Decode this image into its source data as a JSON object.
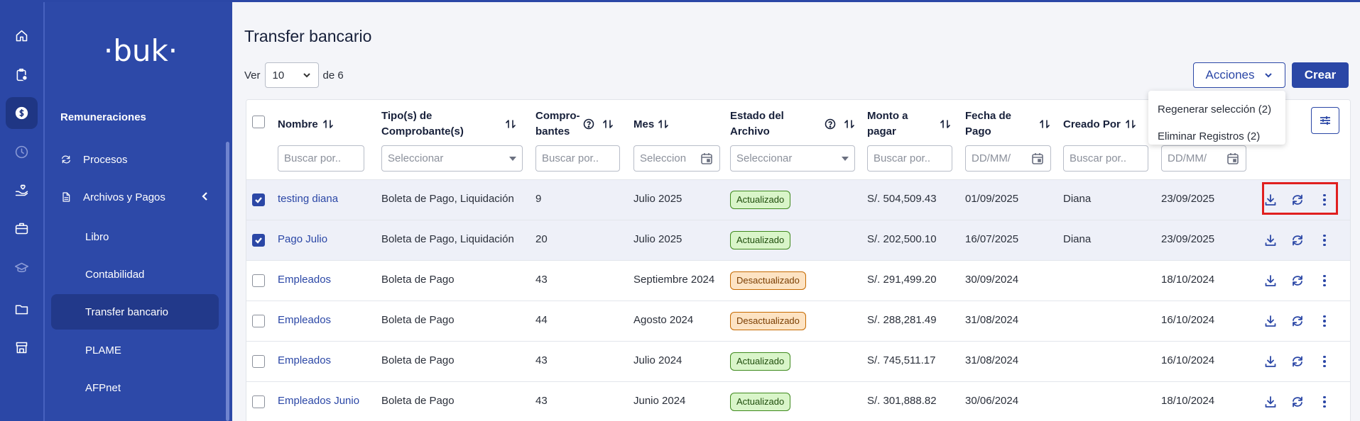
{
  "rail": {
    "items": [
      {
        "icon": "home-icon"
      },
      {
        "icon": "clipboard-clock-icon"
      },
      {
        "icon": "payroll-dollar-icon",
        "active": true
      },
      {
        "icon": "clock-icon"
      },
      {
        "icon": "hand-heart-icon"
      },
      {
        "icon": "briefcase-icon"
      },
      {
        "icon": "graduation-cap-icon"
      },
      {
        "icon": "folder-icon"
      },
      {
        "icon": "store-icon"
      }
    ]
  },
  "sidebar": {
    "logo_text": "·buk·",
    "module_title": "Remuneraciones",
    "procesos_label": "Procesos",
    "archivos_label": "Archivos y Pagos",
    "sub_items": [
      {
        "label": "Libro"
      },
      {
        "label": "Contabilidad"
      },
      {
        "label": "Transfer bancario",
        "active": true
      },
      {
        "label": "PLAME"
      },
      {
        "label": "AFPnet"
      }
    ]
  },
  "page": {
    "title": "Transfer bancario",
    "ver_label": "Ver",
    "ver_value": "10",
    "de_label": "de 6",
    "acciones_label": "Acciones",
    "crear_label": "Crear"
  },
  "dropdown": {
    "items": [
      "Regenerar selección (2)",
      "Eliminar Registros (2)"
    ]
  },
  "table": {
    "headers": {
      "nombre": "Nombre",
      "tipo_1": "Tipo(s) de",
      "tipo_2": "Comprobante(s)",
      "compro_1": "Compro-",
      "compro_2": "bantes",
      "mes": "Mes",
      "estado_1": "Estado del",
      "estado_2": "Archivo",
      "monto_1": "Monto a",
      "monto_2": "pagar",
      "fecha_1": "Fecha de",
      "fecha_2": "Pago",
      "creado": "Creado Por"
    },
    "filters": {
      "buscar": "Buscar por..",
      "seleccionar": "Seleccionar",
      "mes": "Seleccion",
      "fecha": "DD/MM/"
    },
    "rows": [
      {
        "checked": true,
        "nombre": "testing diana",
        "tipo": "Boleta de Pago, Liquidación",
        "comprobantes": "9",
        "mes": "Julio 2025",
        "estado": "Actualizado",
        "estado_kind": "ok",
        "monto": "S/. 504,509.43",
        "fecha_pago": "01/09/2025",
        "creado_por": "Diana",
        "fecha_creacion": "23/09/2025"
      },
      {
        "checked": true,
        "nombre": "Pago Julio",
        "tipo": "Boleta de Pago, Liquidación",
        "comprobantes": "20",
        "mes": "Julio 2025",
        "estado": "Actualizado",
        "estado_kind": "ok",
        "monto": "S/. 202,500.10",
        "fecha_pago": "16/07/2025",
        "creado_por": "Diana",
        "fecha_creacion": "23/09/2025"
      },
      {
        "checked": false,
        "nombre": "Empleados",
        "tipo": "Boleta de Pago",
        "comprobantes": "43",
        "mes": "Septiembre 2024",
        "estado": "Desactualizado",
        "estado_kind": "warn",
        "monto": "S/. 291,499.20",
        "fecha_pago": "30/09/2024",
        "creado_por": "",
        "fecha_creacion": "18/10/2024"
      },
      {
        "checked": false,
        "nombre": "Empleados",
        "tipo": "Boleta de Pago",
        "comprobantes": "44",
        "mes": "Agosto 2024",
        "estado": "Desactualizado",
        "estado_kind": "warn",
        "monto": "S/. 288,281.49",
        "fecha_pago": "31/08/2024",
        "creado_por": "",
        "fecha_creacion": "16/10/2024"
      },
      {
        "checked": false,
        "nombre": "Empleados",
        "tipo": "Boleta de Pago",
        "comprobantes": "43",
        "mes": "Julio 2024",
        "estado": "Actualizado",
        "estado_kind": "ok",
        "monto": "S/. 745,511.17",
        "fecha_pago": "31/08/2024",
        "creado_por": "",
        "fecha_creacion": "16/10/2024"
      },
      {
        "checked": false,
        "nombre": "Empleados Junio",
        "tipo": "Boleta de Pago",
        "comprobantes": "43",
        "mes": "Junio 2024",
        "estado": "Actualizado",
        "estado_kind": "ok",
        "monto": "S/. 301,888.82",
        "fecha_pago": "30/06/2024",
        "creado_por": "",
        "fecha_creacion": "18/10/2024"
      }
    ]
  },
  "colors": {
    "brand": "#2b47a6",
    "highlight": "#e01f1f"
  }
}
